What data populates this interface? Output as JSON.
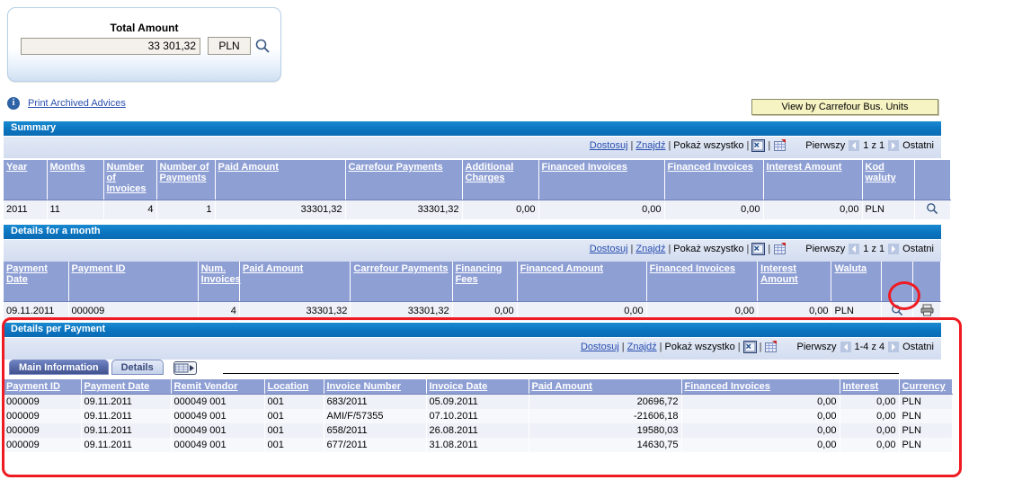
{
  "total_panel": {
    "title": "Total Amount",
    "amount": "33 301,32",
    "currency": "PLN",
    "search_icon": "magnifier-icon"
  },
  "advices": {
    "info_icon": "info-icon",
    "link": "Print Archived Advices"
  },
  "view_by_button": "View by Carrefour Bus. Units",
  "toolbar": {
    "customize": "Dostosuj",
    "find": "Znajdź",
    "show_all": "Pokaż wszystko",
    "sep": "|",
    "export_icon": "export-to-excel-icon",
    "grid_icon": "download-spreadsheet-icon",
    "first": "Pierwszy",
    "last": "Ostatni",
    "prev_icon": "previous-arrow-icon",
    "next_icon": "next-arrow-icon"
  },
  "summary": {
    "title": "Summary",
    "range": "1 z 1",
    "columns": [
      "Year",
      "Months",
      "Number of Invoices",
      "Number of Payments",
      "Paid Amount",
      "Carrefour Payments",
      "Additional Charges",
      "Financed Invoices",
      "Financed Invoices",
      "Interest Amount",
      "Kod waluty",
      ""
    ],
    "rows": [
      {
        "year": "2011",
        "months": "11",
        "number_of_invoices": "4",
        "number_of_payments": "1",
        "paid_amount": "33301,32",
        "carrefour_payments": "33301,32",
        "additional_charges": "0,00",
        "financed_invoices_1": "0,00",
        "financed_invoices_2": "0,00",
        "interest_amount": "0,00",
        "kod_waluty": "PLN",
        "action_icon": "magnifier-icon"
      }
    ]
  },
  "details_month": {
    "title": "Details for a month",
    "range": "1 z 1",
    "columns": [
      "Payment Date",
      "Payment ID",
      "Num. Invoices",
      "Paid Amount",
      "Carrefour Payments",
      "Financing Fees",
      "Financed Amount",
      "Financed Invoices",
      "Interest Amount",
      "Waluta",
      "",
      ""
    ],
    "rows": [
      {
        "payment_date": "09.11.2011",
        "payment_id": "000009",
        "num_invoices": "4",
        "paid_amount": "33301,32",
        "carrefour_payments": "33301,32",
        "financing_fees": "0,00",
        "financed_amount": "0,00",
        "financed_invoices": "0,00",
        "interest_amount": "0,00",
        "waluta": "PLN",
        "detail_icon": "magnifier-icon",
        "print_icon": "printer-icon"
      }
    ]
  },
  "details_payment": {
    "title": "Details per Payment",
    "range": "1-4 z 4",
    "tabs": [
      {
        "label": "Main Information",
        "active": true
      },
      {
        "label": "Details",
        "active": false
      }
    ],
    "grid_icon": "expand-grid-icon",
    "columns": [
      "Payment ID",
      "Payment Date",
      "Remit Vendor",
      "Location",
      "Invoice Number",
      "Invoice Date",
      "Paid Amount",
      "Financed Invoices",
      "Interest",
      "Currency"
    ],
    "rows": [
      {
        "payment_id": "000009",
        "payment_date": "09.11.2011",
        "remit_vendor": "000049 001",
        "location": "001",
        "invoice_number": "683/2011",
        "invoice_date": "05.09.2011",
        "paid_amount": "20696,72",
        "financed_invoices": "0,00",
        "interest": "0,00",
        "currency": "PLN"
      },
      {
        "payment_id": "000009",
        "payment_date": "09.11.2011",
        "remit_vendor": "000049 001",
        "location": "001",
        "invoice_number": "AMI/F/57355",
        "invoice_date": "07.10.2011",
        "paid_amount": "-21606,18",
        "financed_invoices": "0,00",
        "interest": "0,00",
        "currency": "PLN"
      },
      {
        "payment_id": "000009",
        "payment_date": "09.11.2011",
        "remit_vendor": "000049 001",
        "location": "001",
        "invoice_number": "658/2011",
        "invoice_date": "26.08.2011",
        "paid_amount": "19580,03",
        "financed_invoices": "0,00",
        "interest": "0,00",
        "currency": "PLN"
      },
      {
        "payment_id": "000009",
        "payment_date": "09.11.2011",
        "remit_vendor": "000049 001",
        "location": "001",
        "invoice_number": "677/2011",
        "invoice_date": "31.08.2011",
        "paid_amount": "14630,75",
        "financed_invoices": "0,00",
        "interest": "0,00",
        "currency": "PLN"
      }
    ]
  },
  "colors": {
    "section_bar": "#0b74c0",
    "table_header": "#8e9fd4",
    "link": "#2a4faf",
    "annotation": "#ee1b22",
    "button": "#f7f4c3"
  }
}
